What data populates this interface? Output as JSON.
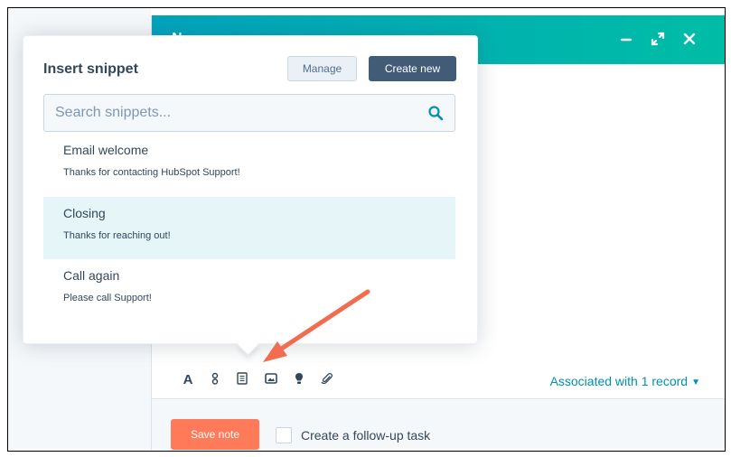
{
  "modal": {
    "title": "N",
    "controls": {
      "minimize_icon": "minimize-icon",
      "expand_icon": "expand-icon",
      "close_icon": "close-icon"
    },
    "header_gradient": [
      "#00a4bd",
      "#00bda5"
    ]
  },
  "snippet_popover": {
    "title": "Insert snippet",
    "manage_label": "Manage",
    "create_label": "Create new",
    "search_placeholder": "Search snippets...",
    "items": [
      {
        "title": "Email welcome",
        "body": "Thanks for contacting HubSpot Support!",
        "selected": false
      },
      {
        "title": "Closing",
        "body": "Thanks for reaching out!",
        "selected": true
      },
      {
        "title": "Call again",
        "body": "Please call Support!",
        "selected": false
      }
    ]
  },
  "toolbar": {
    "tools": [
      "text-format-icon",
      "personalization-token-icon",
      "snippet-icon",
      "image-icon",
      "knowledge-article-icon",
      "attachment-icon"
    ],
    "associated_label": "Associated with 1 record"
  },
  "footer": {
    "save_label": "Save note",
    "followup_label": "Create a follow-up task",
    "followup_checked": false
  },
  "colors": {
    "accent_orange": "#ff7a59",
    "dark_button": "#425b76",
    "link": "#0091ae",
    "selected_row": "#e5f5f8",
    "annotation_arrow": "#f26d4f"
  }
}
